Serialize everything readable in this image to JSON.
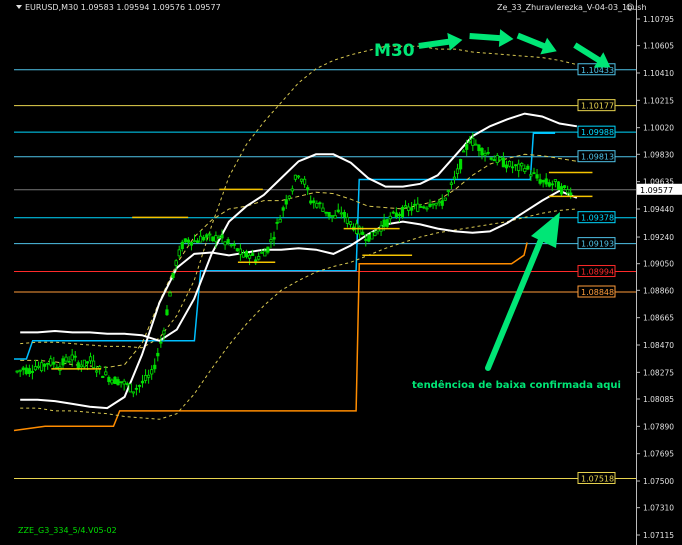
{
  "header": {
    "symbol_info": "EURUSD,M30  1.09583 1.09594 1.09576 1.09577",
    "indicator_name": "Ze_33_Zhuravlerezka_V-04-03_1bush",
    "smiley": "☺",
    "footer_label": "ZZE_G3_334_5/4.V05-02"
  },
  "colors": {
    "background": "#000000",
    "candle": "#00dd00",
    "band": "#ffffff",
    "ma_dashed": "#d8c850",
    "orange_line": "#ff8c00",
    "cyan_line": "#00bfff",
    "yellow_seg": "#f5c400",
    "annotation": "#00e676"
  },
  "annotations": {
    "timeframe_label": "M30",
    "trend_text": "tendêncioa de baixa confirmada aqui"
  },
  "chart_data": {
    "type": "candlestick",
    "symbol": "EURUSD",
    "timeframe": "M30",
    "ylim": [
      1.07115,
      1.11
    ],
    "y_ticks": [
      "1.10795",
      "1.10605",
      "1.10410",
      "1.10215",
      "1.10020",
      "1.09830",
      "1.09635",
      "1.09440",
      "1.09240",
      "1.09050",
      "1.08860",
      "1.08665",
      "1.08470",
      "1.08275",
      "1.08085",
      "1.07890",
      "1.07695",
      "1.07500",
      "1.07310",
      "1.07115"
    ],
    "horizontal_levels": [
      {
        "price": 1.10433,
        "label": "1.10433",
        "color": "#4fc3e8"
      },
      {
        "price": 1.10177,
        "label": "1.10177",
        "color": "#e8d44f"
      },
      {
        "price": 1.09988,
        "label": "1.09988",
        "color": "#00d8ff"
      },
      {
        "price": 1.09813,
        "label": "1.09813",
        "color": "#4fc3e8"
      },
      {
        "price": 1.09577,
        "label": "1.09577",
        "color": "#ffffff",
        "current": true
      },
      {
        "price": 1.09378,
        "label": "1.09378",
        "color": "#00d8ff"
      },
      {
        "price": 1.09193,
        "label": "1.09193",
        "color": "#4fc3e8"
      },
      {
        "price": 1.08994,
        "label": "1.08994",
        "color": "#ff2a2a"
      },
      {
        "price": 1.08848,
        "label": "1.08848",
        "color": "#ff9c3a"
      },
      {
        "price": 1.07518,
        "label": "1.07518",
        "color": "#e8d44f"
      }
    ],
    "price_path": [
      1.0828,
      1.083,
      1.0829,
      1.0832,
      1.0831,
      1.0835,
      1.0834,
      1.0832,
      1.0836,
      1.0838,
      1.0834,
      1.0833,
      1.0836,
      1.0831,
      1.0827,
      1.0824,
      1.0822,
      1.0821,
      1.0818,
      1.0815,
      1.0818,
      1.0822,
      1.0826,
      1.084,
      1.0858,
      1.0884,
      1.0906,
      1.0918,
      1.0922,
      1.0921,
      1.0923,
      1.0924,
      1.0922,
      1.0925,
      1.092,
      1.0918,
      1.0915,
      1.091,
      1.0912,
      1.0908,
      1.0912,
      1.0916,
      1.0926,
      1.0938,
      1.095,
      1.096,
      1.097,
      1.0963,
      1.095,
      1.0948,
      1.0945,
      1.094,
      1.0938,
      1.0942,
      1.0936,
      1.0932,
      1.0928,
      1.0925,
      1.0924,
      1.093,
      1.0933,
      1.0937,
      1.094,
      1.0942,
      1.0944,
      1.0945,
      1.0946,
      1.0947,
      1.095,
      1.0946,
      1.0952,
      1.096,
      1.097,
      1.0982,
      1.0994,
      1.099,
      1.0986,
      1.0984,
      1.098,
      1.0978,
      1.0976,
      1.0974,
      1.0973,
      1.0974,
      1.097,
      1.0966,
      1.0963,
      1.0962,
      1.0962,
      1.0958,
      1.0957,
      1.0957
    ],
    "upper_band": [
      1.0856,
      1.0856,
      1.0857,
      1.0856,
      1.0856,
      1.0855,
      1.0855,
      1.0854,
      1.085,
      1.0858,
      1.088,
      1.0912,
      1.0935,
      1.0946,
      1.0954,
      1.0966,
      1.0978,
      1.0983,
      1.0983,
      1.0977,
      1.0966,
      1.096,
      1.096,
      1.0962,
      1.0968,
      1.0982,
      1.0996,
      1.1003,
      1.1008,
      1.1012,
      1.101,
      1.1005,
      1.1003
    ],
    "lower_band": [
      1.0808,
      1.0808,
      1.0807,
      1.0805,
      1.0803,
      1.0802,
      1.081,
      1.084,
      1.0877,
      1.0902,
      1.0912,
      1.0913,
      1.0911,
      1.0913,
      1.0915,
      1.0915,
      1.0916,
      1.0915,
      1.0912,
      1.0918,
      1.0926,
      1.0933,
      1.0935,
      1.0933,
      1.093,
      1.0928,
      1.0927,
      1.0928,
      1.0934,
      1.0942,
      1.095,
      1.0957,
      1.0952
    ],
    "mid_band": [
      1.0836,
      1.0836,
      1.0835,
      1.0833,
      1.0832,
      1.0831,
      1.0833,
      1.0848,
      1.0878,
      1.0905,
      1.0924,
      1.0936,
      1.0944,
      1.0946,
      1.095,
      1.095,
      1.0953,
      1.0956,
      1.0955,
      1.0951,
      1.0946,
      1.0945,
      1.0944,
      1.0947,
      1.095,
      1.0958,
      1.0968,
      1.0976,
      1.098,
      1.0983,
      1.0982,
      1.098,
      1.0978
    ],
    "outer_upper": [
      1.0848,
      1.0849,
      1.0849,
      1.0848,
      1.0847,
      1.0846,
      1.0846,
      1.0845,
      1.0852,
      1.0868,
      1.0893,
      1.0932,
      1.0967,
      1.099,
      1.1006,
      1.102,
      1.1034,
      1.1044,
      1.105,
      1.1054,
      1.1057,
      1.106,
      1.106,
      1.106,
      1.1058,
      1.1058,
      1.1056,
      1.1055,
      1.1054,
      1.1053,
      1.1052,
      1.105,
      1.1047
    ],
    "outer_lower": [
      1.0802,
      1.0802,
      1.08,
      1.08,
      1.0799,
      1.0798,
      1.0796,
      1.0795,
      1.0794,
      1.0798,
      1.0812,
      1.083,
      1.0847,
      1.0862,
      1.0875,
      1.0886,
      1.0893,
      1.0899,
      1.0903,
      1.0906,
      1.0911,
      1.0916,
      1.092,
      1.0924,
      1.0927,
      1.0929,
      1.0931,
      1.0933,
      1.0935,
      1.0938,
      1.0941,
      1.0943,
      1.0944
    ],
    "orange_steps": [
      [
        0,
        1.0786
      ],
      [
        0.05,
        1.0789
      ],
      [
        0.16,
        1.0789
      ],
      [
        0.17,
        1.08
      ],
      [
        0.55,
        1.08
      ],
      [
        0.555,
        1.0903
      ],
      [
        0.555,
        1.0905
      ],
      [
        0.8,
        1.0905
      ],
      [
        0.81,
        1.0908
      ],
      [
        0.82,
        1.0911
      ],
      [
        0.825,
        1.092
      ]
    ],
    "cyan_steps": [
      [
        0,
        1.0837
      ],
      [
        0.02,
        1.0837
      ],
      [
        0.03,
        1.085
      ],
      [
        0.29,
        1.085
      ],
      [
        0.3,
        1.09
      ],
      [
        0.55,
        1.09
      ],
      [
        0.555,
        1.0965
      ],
      [
        0.83,
        1.0965
      ],
      [
        0.835,
        1.0998
      ],
      [
        0.87,
        1.0998
      ]
    ],
    "yellow_segments": [
      [
        0.06,
        0.14,
        1.083
      ],
      [
        0.19,
        0.28,
        1.0938
      ],
      [
        0.33,
        0.4,
        1.0958
      ],
      [
        0.36,
        0.42,
        1.0906
      ],
      [
        0.53,
        0.62,
        1.093
      ],
      [
        0.56,
        0.64,
        1.0911
      ],
      [
        0.86,
        0.93,
        1.097
      ],
      [
        0.86,
        0.93,
        1.0953
      ]
    ],
    "current_price": 1.09577,
    "grid": false,
    "legend": "none"
  }
}
